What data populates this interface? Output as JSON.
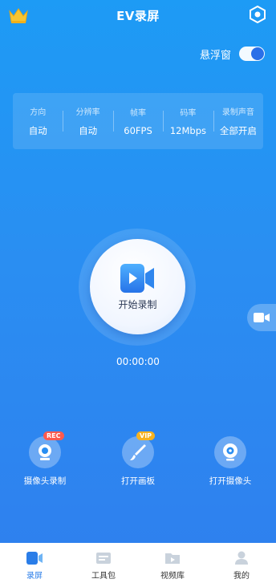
{
  "header": {
    "title": "EV录屏"
  },
  "floating_window": {
    "label": "悬浮窗",
    "enabled": true
  },
  "settings": [
    {
      "label": "方向",
      "value": "自动"
    },
    {
      "label": "分辨率",
      "value": "自动"
    },
    {
      "label": "帧率",
      "value": "60FPS"
    },
    {
      "label": "码率",
      "value": "12Mbps"
    },
    {
      "label": "录制声音",
      "value": "全部开启"
    }
  ],
  "record": {
    "label": "开始录制"
  },
  "timer": "00:00:00",
  "tools": [
    {
      "label": "摄像头录制",
      "badge": "REC",
      "icon": "camera-icon"
    },
    {
      "label": "打开画板",
      "badge": "VIP",
      "icon": "brush-icon"
    },
    {
      "label": "打开摄像头",
      "icon": "webcam-icon"
    }
  ],
  "tabs": [
    {
      "label": "录屏",
      "active": true,
      "icon": "record-icon"
    },
    {
      "label": "工具包",
      "icon": "toolkit-icon"
    },
    {
      "label": "视频库",
      "icon": "folder-icon"
    },
    {
      "label": "我的",
      "icon": "user-icon"
    }
  ],
  "colors": {
    "primary": "#1d9bf5",
    "accent": "#2a7de8",
    "rec_badge": "#ff5a4e",
    "vip_badge": "#f6b21e"
  }
}
